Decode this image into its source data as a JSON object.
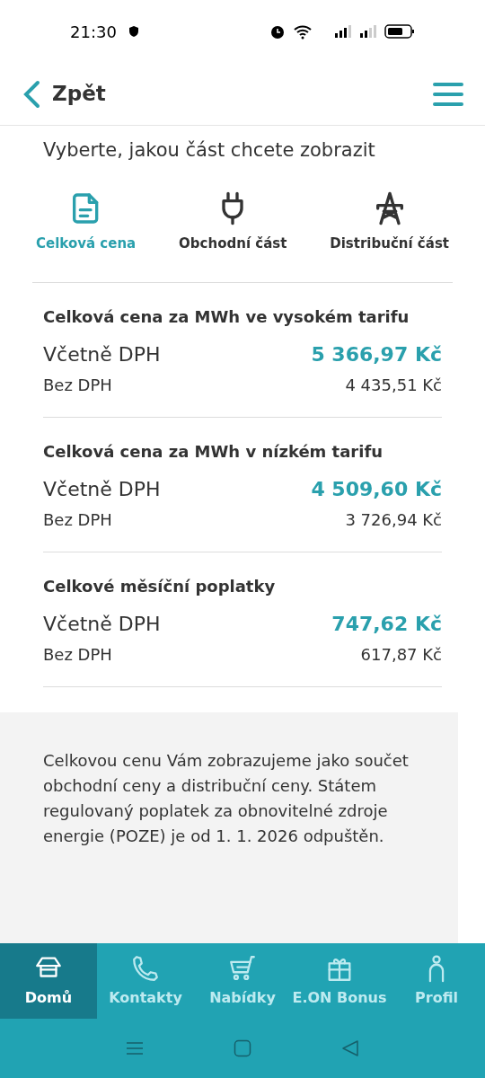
{
  "status_bar": {
    "time": "21:30"
  },
  "header": {
    "back_label": "Zpět"
  },
  "prompt": "Vyberte, jakou část chcete zobrazit",
  "tabs": [
    {
      "label": "Celková cena",
      "kind": "document",
      "selected": true
    },
    {
      "label": "Obchodní část",
      "kind": "plug",
      "selected": false
    },
    {
      "label": "Distribuční část",
      "kind": "pylon",
      "selected": false
    }
  ],
  "sections": [
    {
      "title": "Celková cena za MWh ve vysokém tarifu",
      "with_vat_label": "Včetně DPH",
      "with_vat": "5 366,97 Kč",
      "without_vat_label": "Bez DPH",
      "without_vat": "4 435,51 Kč"
    },
    {
      "title": "Celková cena za MWh v nízkém tarifu",
      "with_vat_label": "Včetně DPH",
      "with_vat": "4 509,60 Kč",
      "without_vat_label": "Bez DPH",
      "without_vat": "3 726,94 Kč"
    },
    {
      "title": "Celkové měsíční poplatky",
      "with_vat_label": "Včetně DPH",
      "with_vat": "747,62 Kč",
      "without_vat_label": "Bez DPH",
      "without_vat": "617,87 Kč"
    }
  ],
  "note": "Celkovou cenu Vám zobrazujeme jako součet obchodní ceny a distribuční ceny. Státem regulovaný poplatek za obnovitelné zdroje energie (POZE) je od 1. 1. 2026 odpuštěn.",
  "bottom_nav": [
    {
      "label": "Domů",
      "kind": "home",
      "selected": true
    },
    {
      "label": "Kontakty",
      "kind": "phone",
      "selected": false
    },
    {
      "label": "Nabídky",
      "kind": "cart",
      "selected": false
    },
    {
      "label": "E.ON Bonus",
      "kind": "gift",
      "selected": false
    },
    {
      "label": "Profil",
      "kind": "person",
      "selected": false
    }
  ]
}
